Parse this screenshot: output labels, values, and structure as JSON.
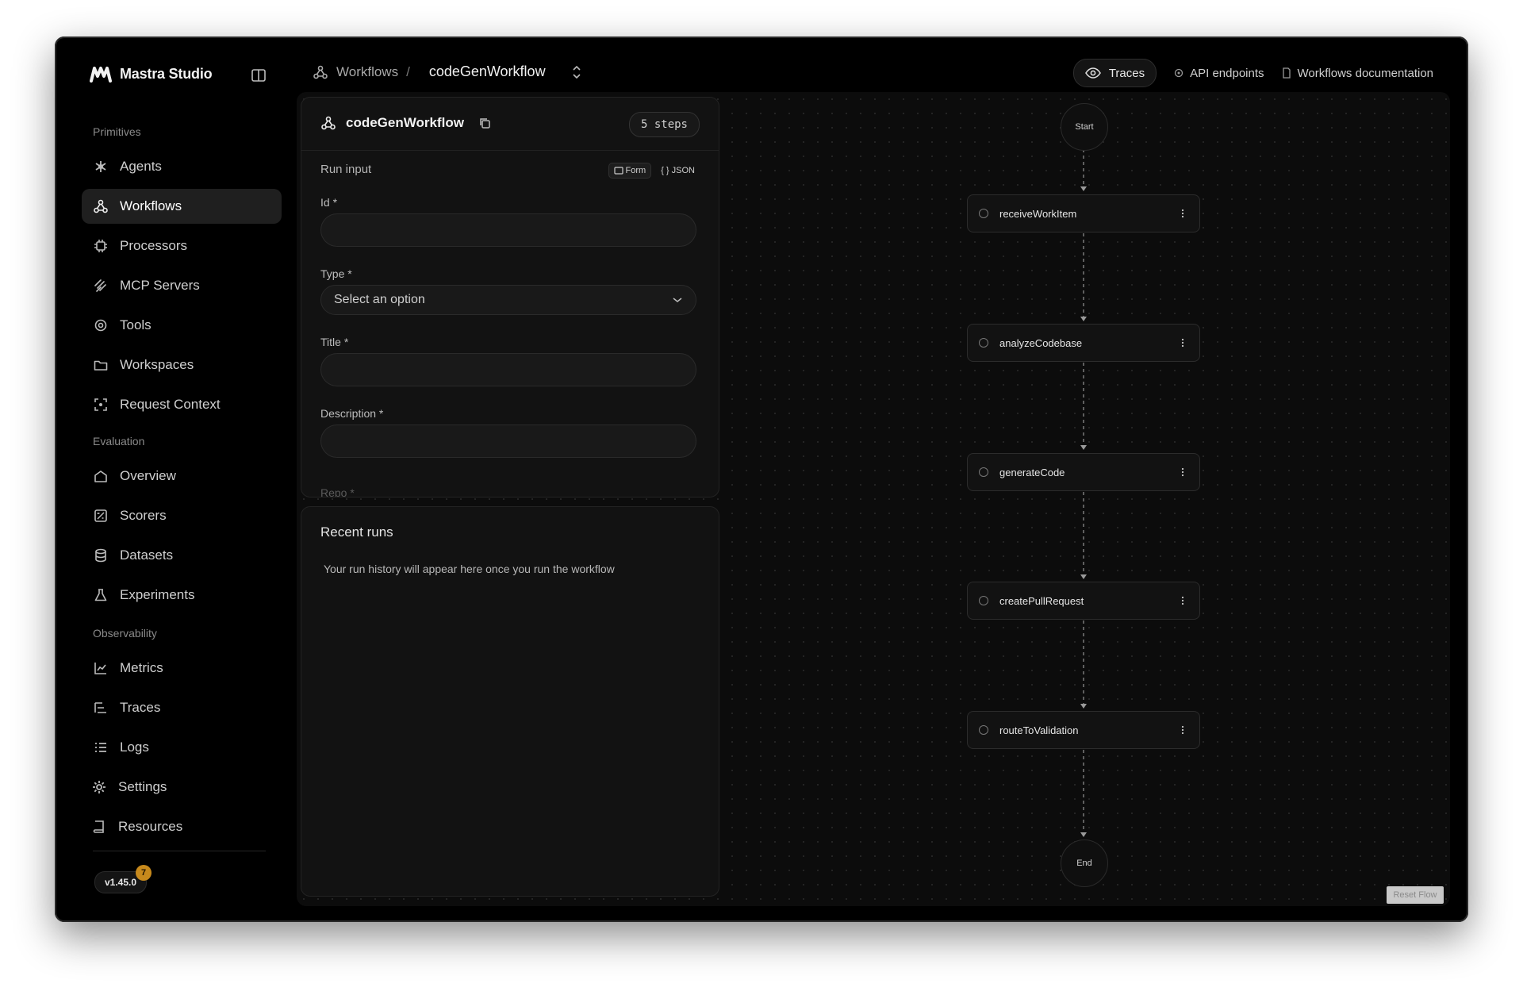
{
  "app": {
    "name": "Mastra Studio",
    "version": "v1.45.0",
    "version_badge": "7"
  },
  "sidebar": {
    "sections": [
      {
        "label": "Primitives"
      },
      {
        "label": "Evaluation"
      },
      {
        "label": "Observability"
      }
    ],
    "items": [
      {
        "label": "Agents",
        "icon": "agents-icon"
      },
      {
        "label": "Workflows",
        "icon": "workflows-icon",
        "active": true
      },
      {
        "label": "Processors",
        "icon": "processor-icon"
      },
      {
        "label": "MCP Servers",
        "icon": "mcp-icon"
      },
      {
        "label": "Tools",
        "icon": "tools-icon"
      },
      {
        "label": "Workspaces",
        "icon": "folder-icon"
      },
      {
        "label": "Request Context",
        "icon": "request-context-icon"
      },
      {
        "label": "Overview",
        "icon": "overview-icon"
      },
      {
        "label": "Scorers",
        "icon": "scorers-icon"
      },
      {
        "label": "Datasets",
        "icon": "database-icon"
      },
      {
        "label": "Experiments",
        "icon": "flask-icon"
      },
      {
        "label": "Metrics",
        "icon": "chart-line-icon"
      },
      {
        "label": "Traces",
        "icon": "traces-icon"
      },
      {
        "label": "Logs",
        "icon": "logs-icon"
      },
      {
        "label": "Settings",
        "icon": "gear-icon"
      },
      {
        "label": "Resources",
        "icon": "book-icon"
      }
    ]
  },
  "header": {
    "breadcrumb_parent": "Workflows",
    "breadcrumb_sep": "/",
    "breadcrumb_current": "codeGenWorkflow",
    "traces_label": "Traces",
    "api_label": "API endpoints",
    "docs_label": "Workflows documentation"
  },
  "workflow_panel": {
    "title": "codeGenWorkflow",
    "steps_count": "5 steps",
    "run_input_label": "Run input",
    "toggle_form": "Form",
    "toggle_json": "{ } JSON",
    "fields": [
      {
        "label": "Id *",
        "value": ""
      },
      {
        "label": "Type *",
        "value": "Select an option"
      },
      {
        "label": "Title *",
        "value": ""
      },
      {
        "label": "Description *",
        "value": ""
      }
    ],
    "next_field_label": "Repo *"
  },
  "recent_runs": {
    "title": "Recent runs",
    "empty_message": "Your run history will appear here once you run the workflow"
  },
  "graph": {
    "start_label": "Start",
    "end_label": "End",
    "steps": [
      "receiveWorkItem",
      "analyzeCodebase",
      "generateCode",
      "createPullRequest",
      "routeToValidation"
    ],
    "reset_label": "Reset Flow"
  }
}
